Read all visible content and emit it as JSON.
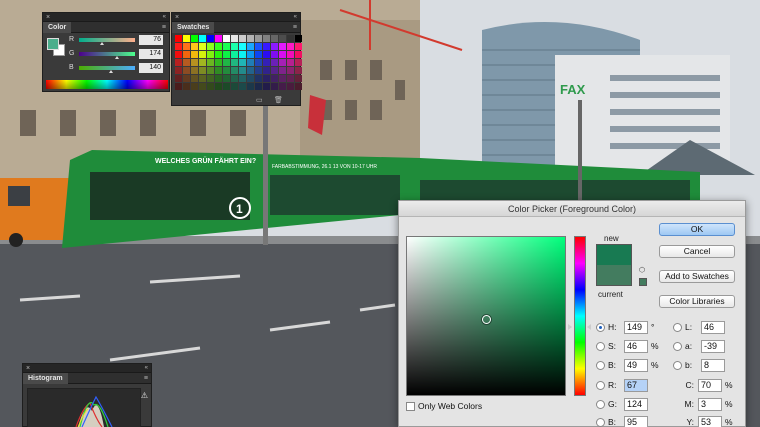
{
  "color_panel": {
    "tab": "Color",
    "close": "×",
    "collapse": "«",
    "menu": "≡",
    "rows": [
      {
        "label": "R",
        "value": "76"
      },
      {
        "label": "G",
        "value": "174"
      },
      {
        "label": "B",
        "value": "140"
      }
    ],
    "foreground": "#4cae8c",
    "background": "#ffffff"
  },
  "swatches_panel": {
    "tab": "Swatches",
    "close": "×",
    "collapse": "«",
    "menu": "≡",
    "footer_new": "▭",
    "footer_delete": "🗑"
  },
  "histogram_panel": {
    "tab": "Histogram",
    "close": "×",
    "collapse": "«",
    "menu": "≡",
    "warning": "⚠"
  },
  "color_picker": {
    "title": "Color Picker (Foreground Color)",
    "new_label": "new",
    "current_label": "current",
    "new_color": "#187a52",
    "current_color": "#437c5f",
    "gamut_icon": "⬡",
    "buttons": {
      "ok": "OK",
      "cancel": "Cancel",
      "add_to_swatches": "Add to Swatches",
      "color_libraries": "Color Libraries"
    },
    "hsb": [
      {
        "key": "h",
        "label": "H:",
        "value": "149",
        "unit": "°",
        "selected": true
      },
      {
        "key": "s",
        "label": "S:",
        "value": "46",
        "unit": "%",
        "selected": false
      },
      {
        "key": "b",
        "label": "B:",
        "value": "49",
        "unit": "%",
        "selected": false
      }
    ],
    "rgb": [
      {
        "key": "r",
        "label": "R:",
        "value": "67"
      },
      {
        "key": "g",
        "label": "G:",
        "value": "124"
      },
      {
        "key": "b",
        "label": "B:",
        "value": "95"
      }
    ],
    "lab": [
      {
        "key": "l",
        "label": "L:",
        "value": "46"
      },
      {
        "key": "a",
        "label": "a:",
        "value": "-39"
      },
      {
        "key": "b",
        "label": "b:",
        "value": "8"
      }
    ],
    "cmyk": [
      {
        "key": "c",
        "label": "C:",
        "value": "70",
        "unit": "%"
      },
      {
        "key": "m",
        "label": "M:",
        "value": "3",
        "unit": "%"
      },
      {
        "key": "y",
        "label": "Y:",
        "value": "53",
        "unit": "%"
      }
    ],
    "only_web_colors": "Only Web Colors"
  },
  "photo": {
    "tram_banner": "WELCHES GRÜN FÄHRT EIN?",
    "tram_text": "FARBABSTIMMUNG, 26.1 13 VON 10-17 UHR",
    "tram_number": "1",
    "building_sign": "FAX"
  }
}
